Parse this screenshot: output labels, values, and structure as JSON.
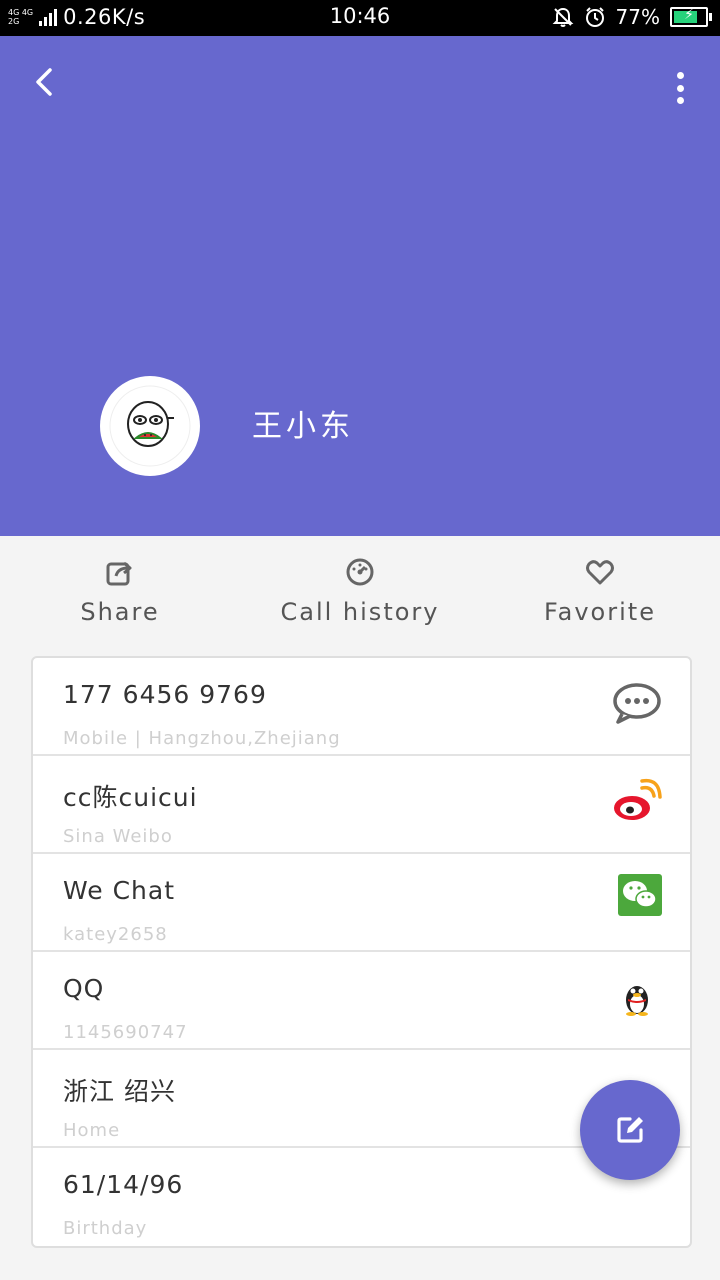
{
  "status_bar": {
    "network_top": "4G 4G",
    "network_bottom": "2G",
    "speed": "0.26K/s",
    "time": "10:46",
    "battery_percent": "77%",
    "battery_level": 0.77
  },
  "header": {
    "contact_name": "王小东",
    "accent_color": "#6768ce"
  },
  "actions": [
    {
      "label": "Share",
      "icon": "share-icon"
    },
    {
      "label": "Call history",
      "icon": "call-history-icon"
    },
    {
      "label": "Favorite",
      "icon": "heart-icon"
    }
  ],
  "details": [
    {
      "main": "177 6456 9769",
      "sub": "Mobile | Hangzhou,Zhejiang",
      "icon": "message-icon"
    },
    {
      "main": "cc陈cuicui",
      "sub": "Sina Weibo",
      "icon": "weibo-icon"
    },
    {
      "main": "We Chat",
      "sub": "katey2658",
      "icon": "wechat-icon"
    },
    {
      "main": "QQ",
      "sub": "1145690747",
      "icon": "qq-penguin-icon"
    },
    {
      "main": "浙江 绍兴",
      "sub": "Home",
      "icon": ""
    },
    {
      "main": "61/14/96",
      "sub": "Birthday",
      "icon": ""
    }
  ],
  "fab": {
    "icon": "edit-icon"
  }
}
